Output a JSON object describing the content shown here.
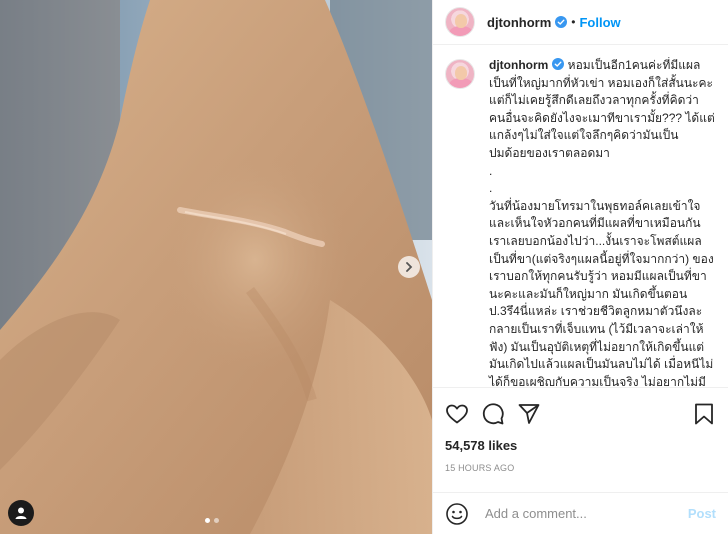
{
  "header": {
    "username": "djtonhorm",
    "separator": "•",
    "follow_label": "Follow"
  },
  "caption": {
    "username": "djtonhorm",
    "text": "หอมเป็นอีก1คนค่ะที่มีแผลเป็นที่ใหญ่มากที่หัวเข่า หอมเองก็ใส่สั้นนะคะ แต่ก็ไม่เคยรู้สึกดีเลยถึงวลาทุกครั้งที่คิดว่าคนอื่นจะคิดยังไงจะเมาทีขาเรามั้ย??? ได้แต่แกล้งๆไม่ใส่ใจแต่ใจลึกๆคิดว่ามันเป็นปมด้อยของเราตลอดมา\n.\n.\nวันที่น้องมายโทรมาในพุธทอล์คเลยเข้าใจและเห็นใจหัวอกคนที่มีแผลที่ขาเหมือนกัน เราเลยบอกน้องไปว่า...งั้นเราจะโพสต์แผลเป็นที่ขา(แต่จริงๆแผลนี้อยู่ที่ใจมากกว่า) ของเราบอกให้ทุกคนรับรู้ว่า หอมมีแผลเป็นที่ขานะคะและมันก็ใหญ่มาก มันเกิดขึ้นตอน ป.3รึ4นี่แหล่ะ เราช่วยชีวิตลูกหมาตัวนึงละกลายเป็นเราที่เจ็บแทน (ไว้มีเวลาจะเล่าให้ฟัง) มันเป็นอุบัติเหตุที่ไม่อยากให้เกิดขึ้นแต่มันเกิดไปแล้วแผลเป็นมันลบไม่ได้ เมื่อหนีไม่ได้ก็ขอเผชิญกับความเป็นจริง ไม่อยากไม่มีใจเวลาอายหมาอีกแล้ว... ถึงมีแผลเป็นแรง"
  },
  "likes": "54,578 likes",
  "time": "15 HOURS AGO",
  "comment_box": {
    "placeholder": "Add a comment...",
    "post_label": "Post"
  },
  "colors": {
    "link_blue": "#0095f6",
    "post_disabled": "#b2dffc",
    "verified_blue": "#3897f0"
  },
  "icons": [
    "verified-badge-icon",
    "heart-icon",
    "comment-icon",
    "share-icon",
    "bookmark-icon",
    "chevron-right-icon",
    "user-tag-icon",
    "emoji-icon"
  ],
  "carousel": {
    "slide_count": 2,
    "active_index": 0
  }
}
